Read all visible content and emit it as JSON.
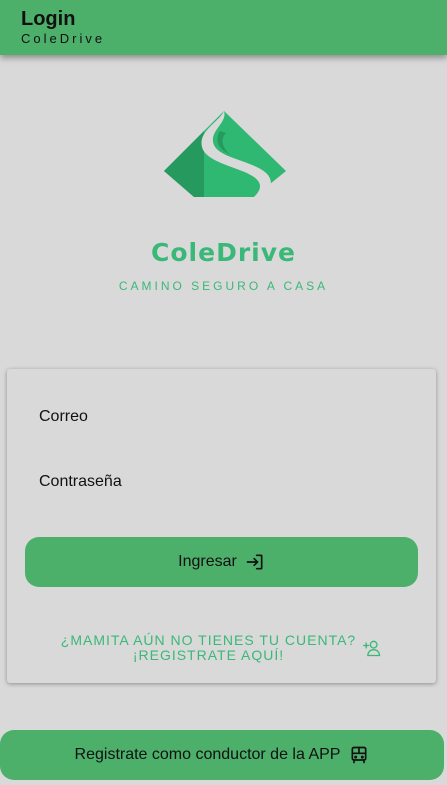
{
  "appbar": {
    "title": "Login",
    "subtitle": "ColeDrive"
  },
  "brand": {
    "name": "ColeDrive",
    "tagline": "CAMINO SEGURO A CASA",
    "logo_icon": "road-diamond-logo"
  },
  "login_form": {
    "email_label": "Correo",
    "email_value": "",
    "password_label": "Contraseña",
    "password_value": "",
    "submit_label": "Ingresar",
    "submit_icon": "login-icon",
    "register_line1": "¿MAMITA AÚN NO TIENES TU CUENTA?",
    "register_line2": "¡REGISTRATE AQUÍ!",
    "register_icon": "add-user-icon"
  },
  "driver_button": {
    "label": "Registrate como conductor de la APP",
    "icon": "bus-icon"
  },
  "colors": {
    "primary": "#4caf6a",
    "accent_text": "#3ab878",
    "background": "#d9d9d9"
  }
}
